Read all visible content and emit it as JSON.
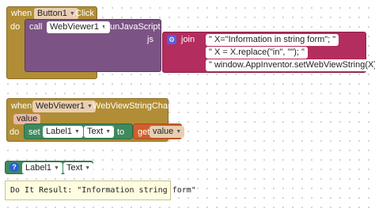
{
  "block1": {
    "when": "when",
    "component": "Button1",
    "event": ".Click",
    "do": "do",
    "call": "call",
    "call_component": "WebViewer1",
    "method": ".RunJavaScript",
    "js_label": "js",
    "join_label": "join",
    "strings": [
      "\" X=\"Information in string form\"; \"",
      "\" X = X.replace(\"in\", \"\"); \"",
      "\" window.AppInventor.setWebViewString(X); \""
    ]
  },
  "block2": {
    "when": "when",
    "component": "WebViewer1",
    "event": ".WebViewStringChange",
    "param": "value",
    "do": "do",
    "set": "set",
    "set_component": "Label1",
    "dot": ".",
    "property": "Text",
    "to": "to",
    "get": "get",
    "get_var": "value"
  },
  "block3": {
    "component": "Label1",
    "dot": ".",
    "property": "Text",
    "result": "Do It Result: \"Information  string form\""
  },
  "colors": {
    "event": "#b18e35",
    "procedure": "#7c5385",
    "text": "#b32d5e",
    "component": "#3e8a5e",
    "variable": "#d05f2d"
  }
}
